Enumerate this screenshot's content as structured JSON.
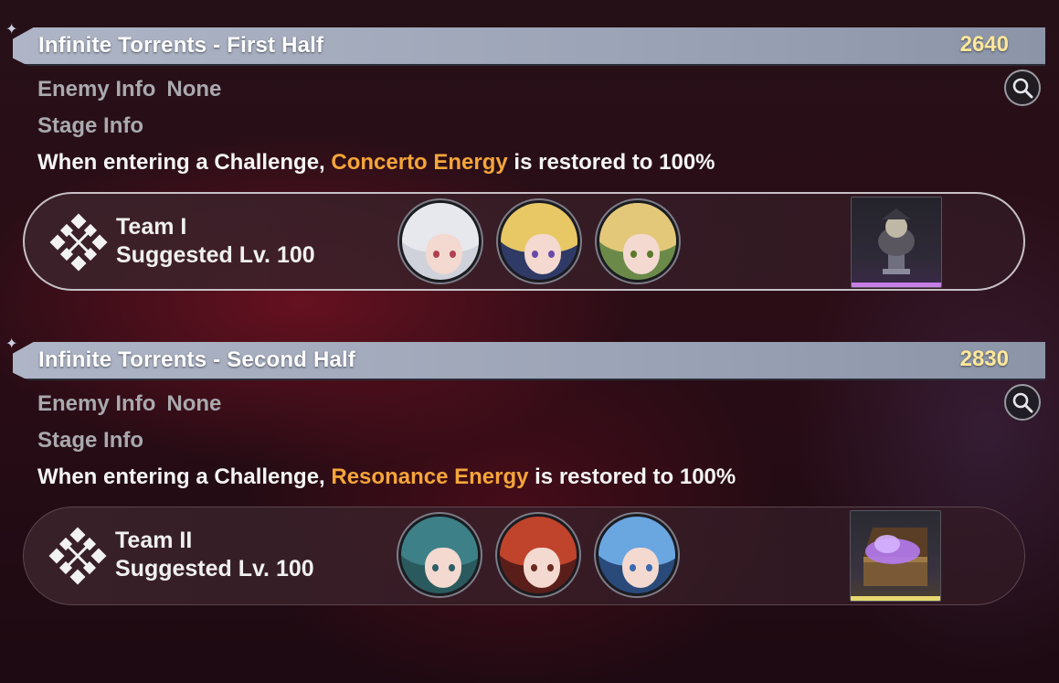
{
  "sections": [
    {
      "title": "Infinite Torrents - First Half",
      "score": "2640",
      "enemy_info_label": "Enemy Info",
      "enemy_info_value": "None",
      "stage_info_label": "Stage Info",
      "desc_before": "When entering a Challenge, ",
      "desc_highlight": "Concerto Energy",
      "desc_after": " is restored to 100%",
      "team": {
        "name": "Team I",
        "level": "Suggested Lv. 100"
      },
      "avatars": [
        "character-white-hair",
        "character-blonde-hat",
        "character-green-bow"
      ],
      "reward_icon": "bust-statue-icon",
      "reward_color": "#c77ee6"
    },
    {
      "title": "Infinite Torrents - Second Half",
      "score": "2830",
      "enemy_info_label": "Enemy Info",
      "enemy_info_value": "None",
      "stage_info_label": "Stage Info",
      "desc_before": "When entering a Challenge, ",
      "desc_highlight": "Resonance Energy",
      "desc_after": " is restored to 100%",
      "team": {
        "name": "Team II",
        "level": "Suggested Lv. 100"
      },
      "avatars": [
        "character-teal-hair",
        "character-red-hair",
        "character-blue-hair"
      ],
      "reward_icon": "treasure-chest-icon",
      "reward_color": "#e8d870"
    }
  ],
  "colors": {
    "highlight": "#f5a53a",
    "score": "#ffe89a",
    "title_bar": "#a9b0c2"
  }
}
